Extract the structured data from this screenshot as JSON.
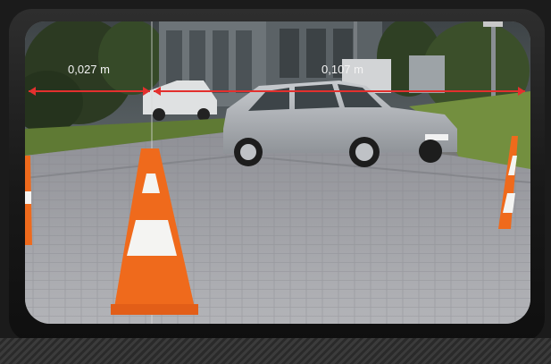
{
  "scene": {
    "description_icons": [
      "traffic-cone-icon",
      "car-icon",
      "building-icon",
      "tree-icon"
    ],
    "measurements": [
      {
        "label": "0,027 m"
      },
      {
        "label": "0,107 m"
      }
    ],
    "colors": {
      "measure_line": "#e3302e",
      "cone_orange": "#ef6a1c",
      "cone_white": "#f4f4f2",
      "car_silver": "#a9adb2",
      "pavement": "#9a9ba0",
      "grass": "#6e8a3a",
      "bezel": "#1b1b1b"
    }
  }
}
